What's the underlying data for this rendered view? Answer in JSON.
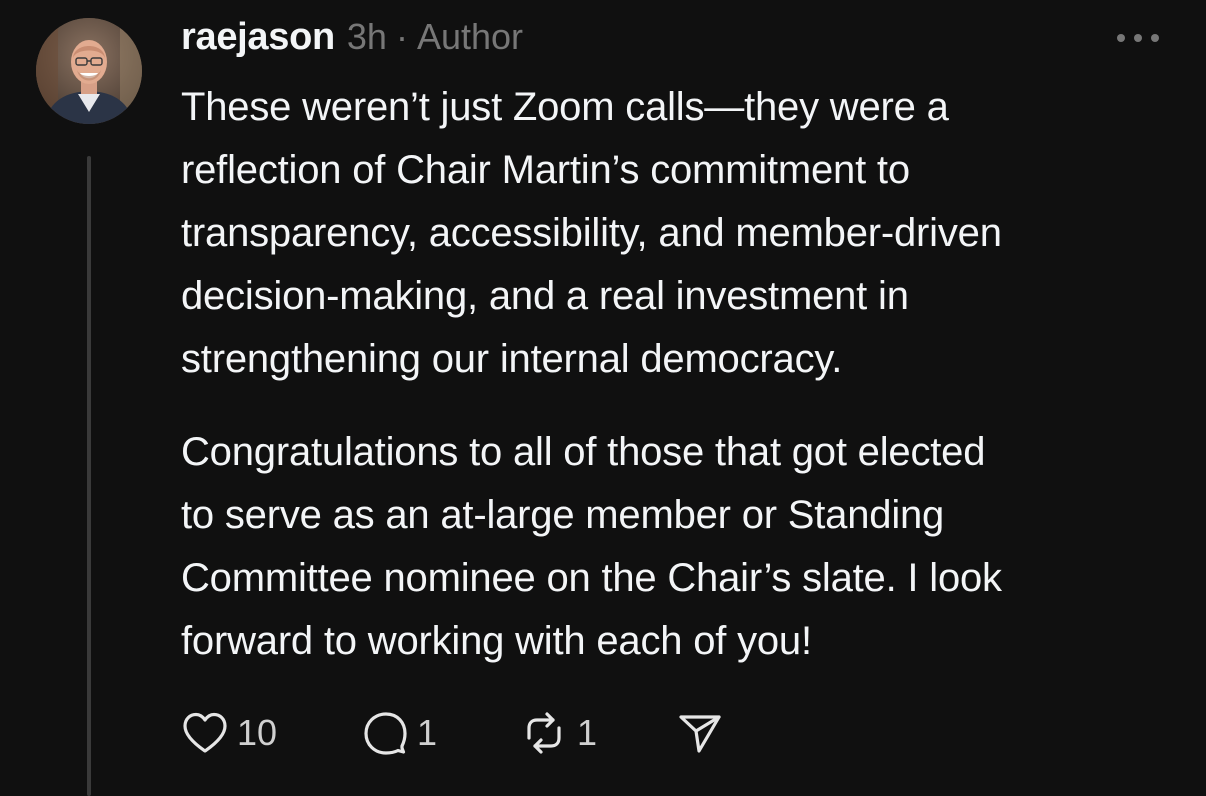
{
  "post": {
    "author": "raejason",
    "timestamp": "3h",
    "separator": "·",
    "role_label": "Author",
    "paragraphs": [
      "These weren’t just Zoom calls—they were a\nreflection of Chair Martin’s commitment to\ntransparency, accessibility, and member-driven\ndecision-making, and a real investment in\nstrengthening our internal democracy.",
      "Congratulations to all of those that got elected\nto serve as an at-large member or Standing\nCommittee nominee on the Chair’s slate. I look\nforward to working with each of you!"
    ]
  },
  "actions": {
    "like_count": "10",
    "reply_count": "1",
    "repost_count": "1"
  },
  "icons": {
    "like": "heart-icon",
    "reply": "comment-bubble-icon",
    "repost": "repost-icon",
    "share": "send-icon",
    "more": "more-horizontal-icon"
  },
  "colors": {
    "background": "#101010",
    "text_primary": "#f3f5f7",
    "text_secondary": "#777777",
    "thread_line": "#3a3a3a"
  }
}
